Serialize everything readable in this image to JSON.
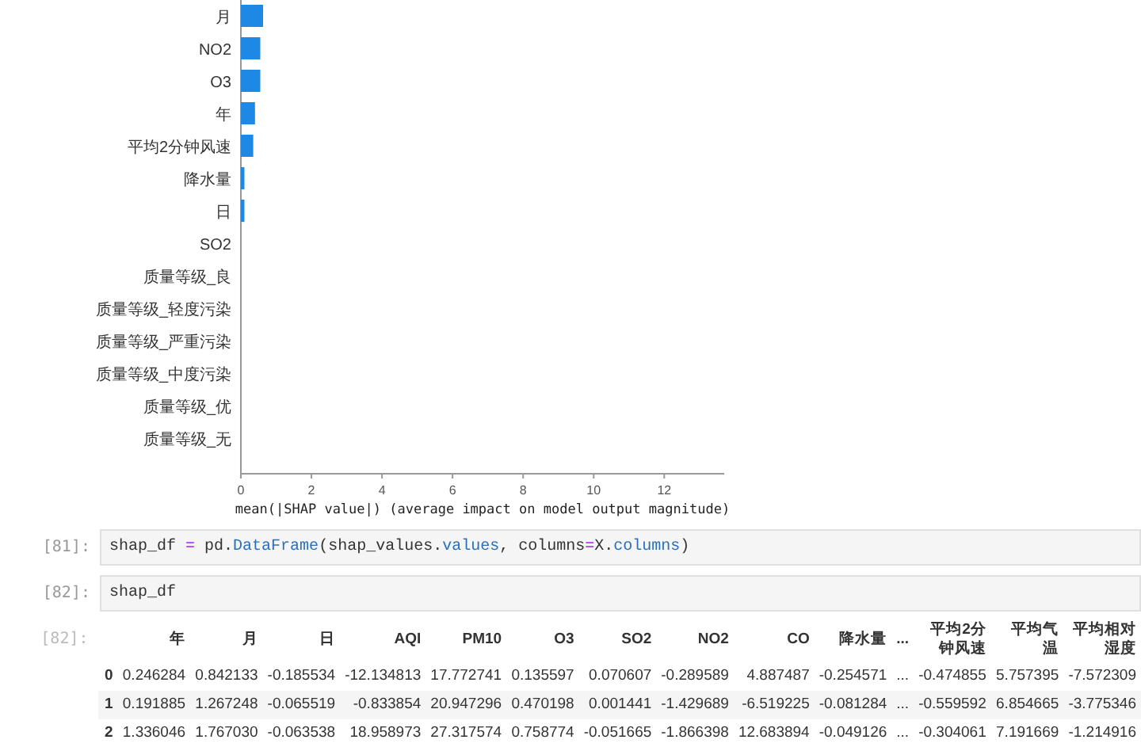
{
  "chart": {
    "chart_data": {
      "type": "bar",
      "orientation": "horizontal",
      "xlabel": "mean(|SHAP value|) (average impact on model output magnitude)",
      "categories": [
        "月",
        "NO2",
        "O3",
        "年",
        "平均2分钟风速",
        "降水量",
        "日",
        "SO2",
        "质量等级_良",
        "质量等级_轻度污染",
        "质量等级_严重污染",
        "质量等级_中度污染",
        "质量等级_优",
        "质量等级_无"
      ],
      "values": [
        0.63,
        0.55,
        0.55,
        0.4,
        0.35,
        0.1,
        0.1,
        0,
        0,
        0,
        0,
        0,
        0,
        0
      ],
      "xlim": [
        0,
        13.7
      ],
      "xticks": [
        0,
        2,
        4,
        6,
        8,
        10,
        12
      ]
    }
  },
  "cells": [
    {
      "prompt": "[81]:",
      "code": [
        {
          "text": "shap_df ",
          "kind": "plain"
        },
        {
          "text": "=",
          "kind": "op"
        },
        {
          "text": " pd.",
          "kind": "plain"
        },
        {
          "text": "DataFrame",
          "kind": "attr"
        },
        {
          "text": "(shap_values.",
          "kind": "plain"
        },
        {
          "text": "values",
          "kind": "attr"
        },
        {
          "text": ", columns",
          "kind": "plain"
        },
        {
          "text": "=",
          "kind": "op"
        },
        {
          "text": "X.",
          "kind": "plain"
        },
        {
          "text": "columns",
          "kind": "attr"
        },
        {
          "text": ")",
          "kind": "plain"
        }
      ]
    },
    {
      "prompt": "[82]:",
      "code": [
        {
          "text": "shap_df",
          "kind": "plain"
        }
      ]
    }
  ],
  "output": {
    "prompt": "[82]:",
    "table": {
      "columns": [
        "年",
        "月",
        "日",
        "AQI",
        "PM10",
        "O3",
        "SO2",
        "NO2",
        "CO",
        "降水量",
        "...",
        "平均2分钟风速",
        "平均气温",
        "平均相对湿度"
      ],
      "rows": [
        {
          "index": "0",
          "cells": [
            "0.246284",
            "0.842133",
            "-0.185534",
            "-12.134813",
            "17.772741",
            "0.135597",
            "0.070607",
            "-0.289589",
            "4.887487",
            "-0.254571",
            "...",
            "-0.474855",
            "5.757395",
            "-7.572309"
          ]
        },
        {
          "index": "1",
          "cells": [
            "0.191885",
            "1.267248",
            "-0.065519",
            "-0.833854",
            "20.947296",
            "0.470198",
            "0.001441",
            "-1.429689",
            "-6.519225",
            "-0.081284",
            "...",
            "-0.559592",
            "6.854665",
            "-3.775346"
          ]
        },
        {
          "index": "2",
          "cells": [
            "1.336046",
            "1.767030",
            "-0.063538",
            "18.958973",
            "27.317574",
            "0.758774",
            "-0.051665",
            "-1.866398",
            "12.683894",
            "-0.049126",
            "...",
            "-0.304061",
            "7.191669",
            "-1.214916"
          ]
        }
      ]
    }
  }
}
